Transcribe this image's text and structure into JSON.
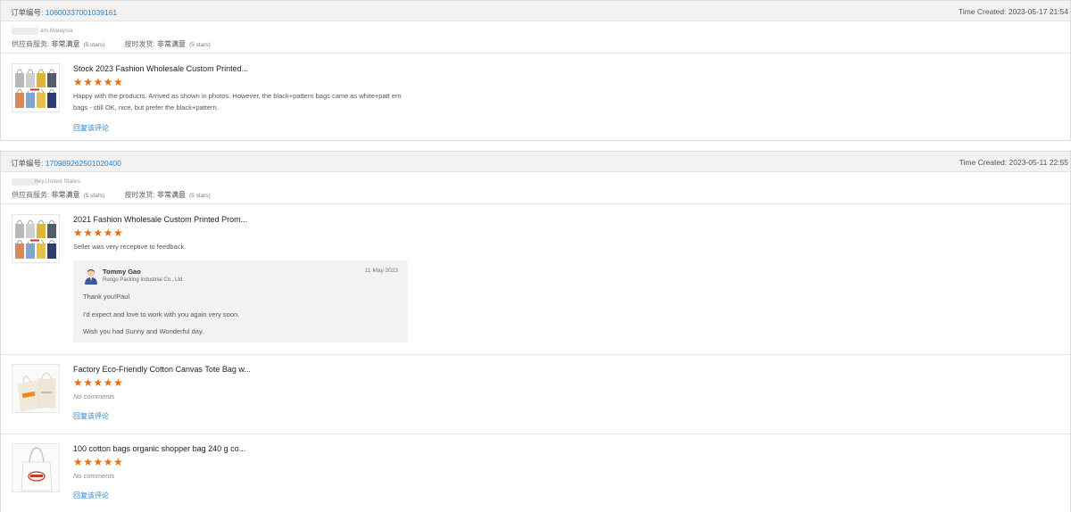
{
  "order_label": "订单编号:",
  "time_label": "Time Created:",
  "supplier_service_label": "供应商服务:",
  "shipping_label": "按时发货:",
  "rating_text": "非常满意",
  "rating_scale": "(5 stars)",
  "reply_link_text": "回复该评论",
  "no_comments_text": "No comments",
  "star_color": "#e46f1b",
  "link_color": "#2a7fc6",
  "orders": [
    {
      "number": "10600337001039161",
      "time": "2023-05-17 21:54",
      "buyer_location": "am,Malaysia",
      "items": [
        {
          "title": "Stock 2023 Fashion Wholesale Custom Printed...",
          "rating": 5,
          "comment": "Happy with the products. Arrived as shown in photos. However, the black+pattern bags came as white+patt ern bags - still OK, nice, but prefer the black+pattern."
        }
      ]
    },
    {
      "number": "170989262501020400",
      "time": "2023-05-11 22:55",
      "buyer_location": "ney,United States",
      "items": [
        {
          "title": "2021 Fashion Wholesale Custom Printed Prom...",
          "rating": 5,
          "comment": "Seller was very receptive to feedback.",
          "reply": {
            "name": "Tommy Gao",
            "company": "Rungo Packing Industrial Co., Ltd.",
            "date": "11 May 2023",
            "lines": [
              "Thank you!Paul",
              "I'd expect and love to work with you again very soon.",
              "Wish you had Sunny and Wonderful day."
            ]
          }
        },
        {
          "title": "Factory Eco-Friendly Cotton Canvas Tote Bag w...",
          "rating": 5,
          "comment": ""
        },
        {
          "title": "100 cotton bags organic shopper bag 240 g co...",
          "rating": 5,
          "comment": ""
        }
      ]
    }
  ]
}
